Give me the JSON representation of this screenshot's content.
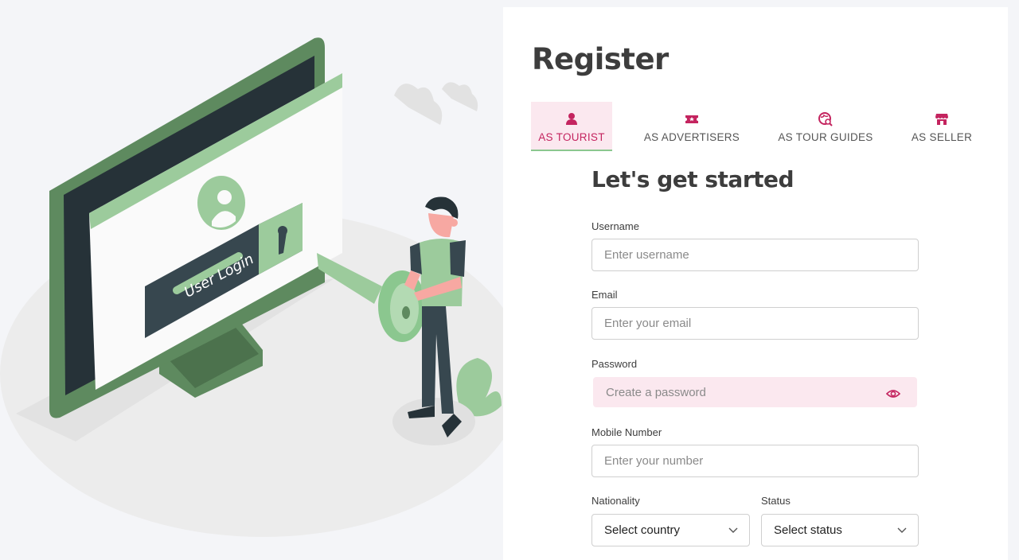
{
  "illustration": {
    "screen_text": "User Login"
  },
  "form": {
    "title": "Register",
    "tabs": [
      {
        "label": "AS TOURIST",
        "icon": "person-icon",
        "active": true
      },
      {
        "label": "AS ADVERTISERS",
        "icon": "ticket-icon",
        "active": false
      },
      {
        "label": "AS TOUR GUIDES",
        "icon": "globe-search-icon",
        "active": false
      },
      {
        "label": "AS SELLER",
        "icon": "store-icon",
        "active": false
      }
    ],
    "subtitle": "Let's get started",
    "fields": {
      "username": {
        "label": "Username",
        "placeholder": "Enter username"
      },
      "email": {
        "label": "Email",
        "placeholder": "Enter your email"
      },
      "password": {
        "label": "Password",
        "placeholder": "Create a password"
      },
      "mobile": {
        "label": "Mobile Number",
        "placeholder": "Enter your number"
      },
      "nationality": {
        "label": "Nationality",
        "value": "Select country"
      },
      "status": {
        "label": "Status",
        "value": "Select status"
      }
    }
  },
  "colors": {
    "accent": "#c4245f",
    "accent_bg": "#fbe8ef",
    "green": "#8bc78f"
  }
}
